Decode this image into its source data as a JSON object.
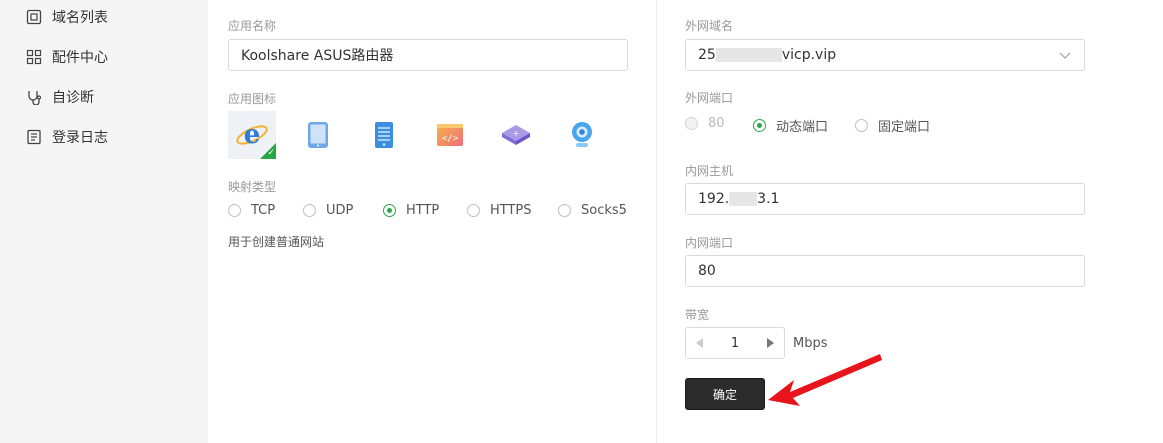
{
  "sidebar": {
    "items": [
      {
        "label": "域名列表",
        "icon": "domain-list-icon"
      },
      {
        "label": "配件中心",
        "icon": "grid-icon"
      },
      {
        "label": "自诊断",
        "icon": "stethoscope-icon"
      },
      {
        "label": "登录日志",
        "icon": "log-icon"
      }
    ]
  },
  "left": {
    "app_name_label": "应用名称",
    "app_name_value": "Koolshare ASUS路由器",
    "app_icon_label": "应用图标",
    "app_icons": [
      "ie-icon",
      "tablet-icon",
      "server-icon",
      "code-icon",
      "router-icon",
      "camera-icon"
    ],
    "selected_icon_index": 0,
    "mapping_label": "映射类型",
    "mapping_options": [
      "TCP",
      "UDP",
      "HTTP",
      "HTTPS",
      "Socks5"
    ],
    "mapping_selected": "HTTP",
    "mapping_hint": "用于创建普通网站"
  },
  "right": {
    "domain_label": "外网域名",
    "domain_prefix": "25",
    "domain_suffix": "vicp.vip",
    "ext_port_label": "外网端口",
    "ext_port_options": [
      "80",
      "动态端口",
      "固定端口"
    ],
    "ext_port_selected": "动态端口",
    "host_label": "内网主机",
    "host_prefix": "192.",
    "host_suffix": "3.1",
    "int_port_label": "内网端口",
    "int_port_value": "80",
    "bandwidth_label": "带宽",
    "bandwidth_value": "1",
    "bandwidth_unit": "Mbps",
    "confirm_label": "确定"
  },
  "colors": {
    "accent_green": "#27a844",
    "arrow_red": "#e8141c",
    "button_dark": "#2b2b2b"
  }
}
